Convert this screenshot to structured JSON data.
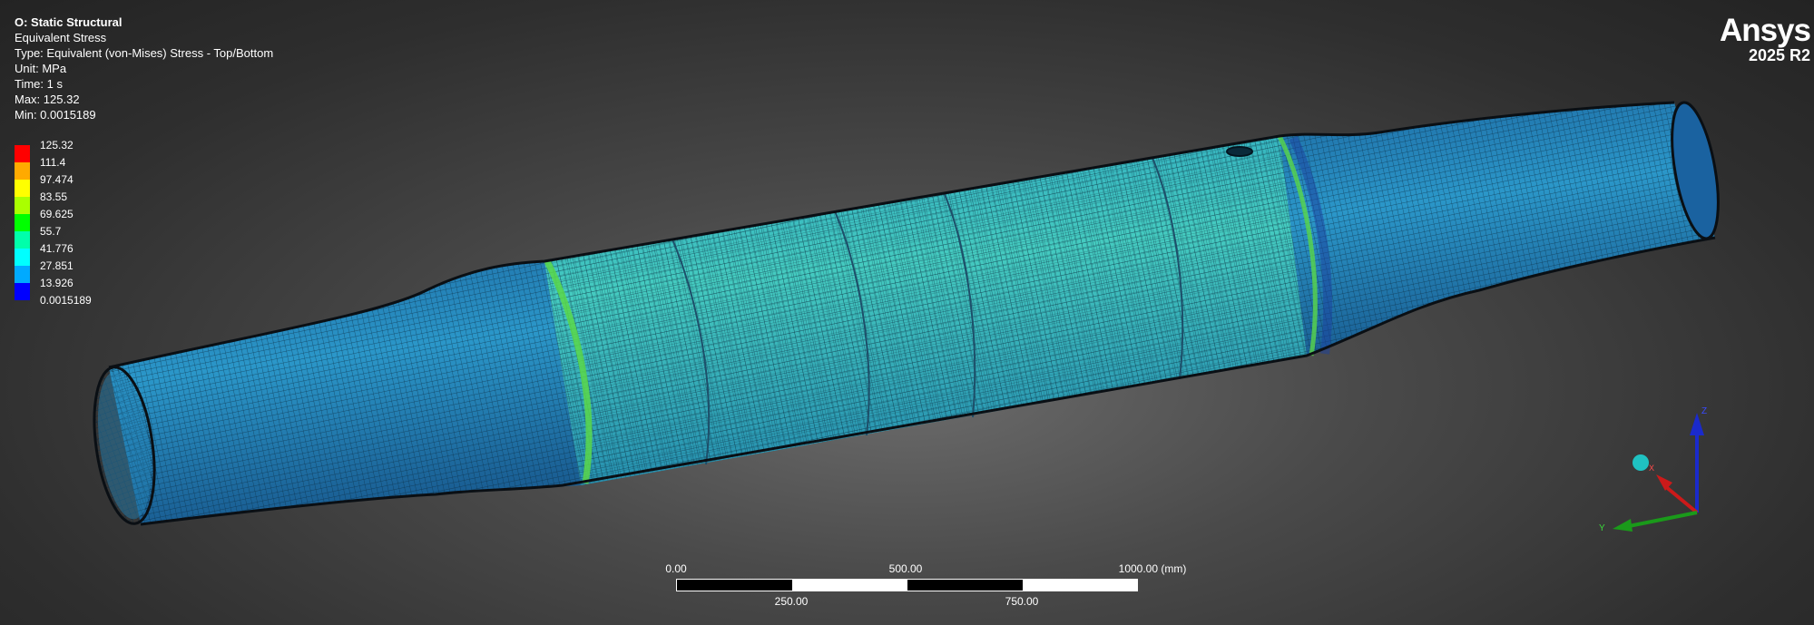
{
  "info": {
    "title": "O: Static Structural",
    "result_name": "Equivalent Stress",
    "type_line": "Type: Equivalent (von-Mises) Stress - Top/Bottom",
    "unit_line": "Unit: MPa",
    "time_line": "Time: 1 s",
    "max_line": "Max: 125.32",
    "min_line": "Min: 0.0015189"
  },
  "legend": {
    "labels": [
      "125.32",
      "111.4",
      "97.474",
      "83.55",
      "69.625",
      "55.7",
      "41.776",
      "27.851",
      "13.926",
      "0.0015189"
    ],
    "colors": [
      "#ff0000",
      "#ffaa00",
      "#ffff00",
      "#aaff00",
      "#00ff00",
      "#00ffaa",
      "#00ffff",
      "#00aaff",
      "#0000ff"
    ]
  },
  "logo": {
    "brand": "Ansys",
    "version": "2025 R2"
  },
  "scale": {
    "ticks_top": [
      "0.00",
      "500.00",
      "1000.00 (mm)"
    ],
    "ticks_bottom": [
      "250.00",
      "750.00"
    ]
  },
  "triad": {
    "z": "Z",
    "x": "X",
    "y": "Y",
    "x_color": "#cc1a1a",
    "y_color": "#1a9a1a",
    "z_color": "#1a2acc",
    "iso_color": "#1fc2c2"
  },
  "model": {
    "description_colors": {
      "shell": "#2a8fc7",
      "center": "#3fc7c0",
      "edge": "#5ad84a"
    }
  }
}
